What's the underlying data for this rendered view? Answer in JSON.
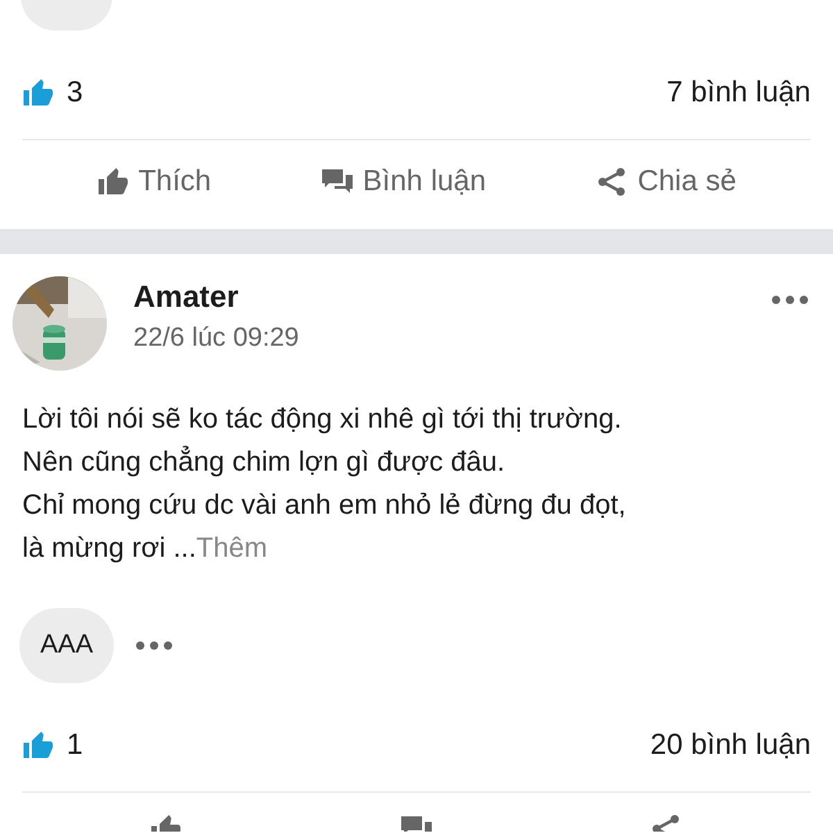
{
  "top_post": {
    "likes": "3",
    "comments": "7 bình luận",
    "actions": [
      {
        "kind": "like",
        "label": "Thích"
      },
      {
        "kind": "comment",
        "label": "Bình luận"
      },
      {
        "kind": "share",
        "label": "Chia sẻ"
      }
    ]
  },
  "post": {
    "author": "Amater",
    "time": "22/6 lúc 09:29",
    "body": "Lời tôi nói sẽ ko tác động xi nhê gì tới thị trường.\nNên cũng chẳng chim lợn gì được đâu.\nChỉ mong cứu dc vài anh em nhỏ lẻ đừng đu đọt,\nlà mừng rơi ...",
    "more_link": "Thêm",
    "tags": [
      "AAA"
    ],
    "likes": "1",
    "comments": "20 bình luận",
    "actions": [
      {
        "kind": "like"
      },
      {
        "kind": "comment"
      },
      {
        "kind": "share"
      }
    ]
  }
}
